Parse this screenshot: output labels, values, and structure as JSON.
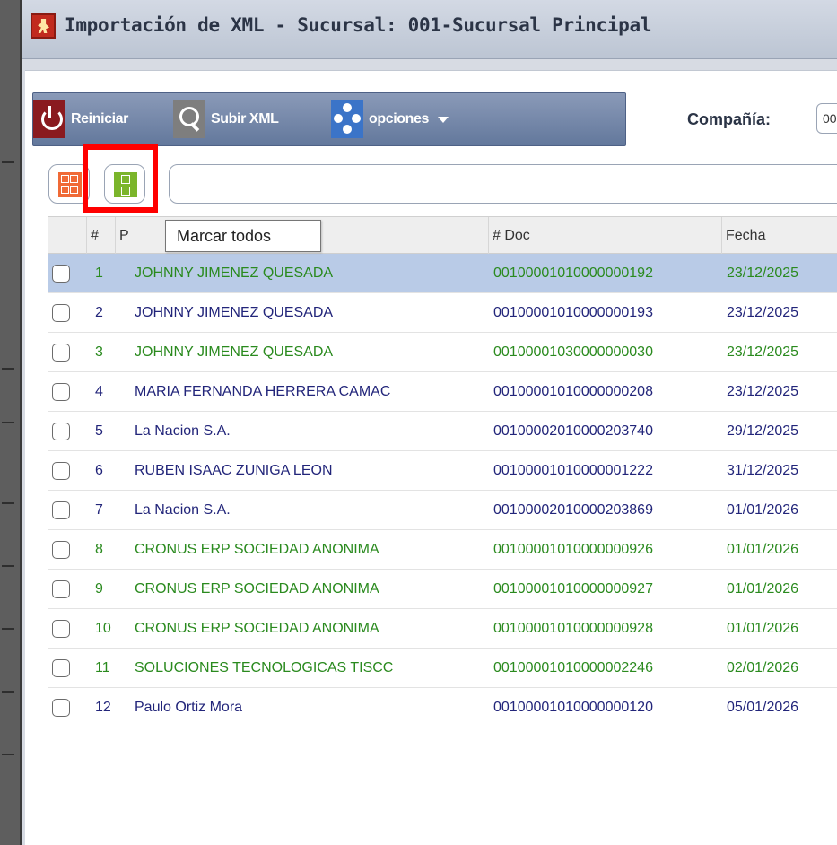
{
  "window": {
    "title": "Importación de XML - Sucursal: 001-Sucursal Principal"
  },
  "toolbar": {
    "reiniciar_label": "Reiniciar",
    "subir_label": "Subir XML",
    "opciones_label": "opciones"
  },
  "company": {
    "label": "Compañía:",
    "value": "00"
  },
  "tooltip": "Marcar todos",
  "table": {
    "columns": [
      "#",
      "P",
      "# Doc",
      "Fecha"
    ],
    "rows": [
      {
        "num": "1",
        "name": "JOHNNY  JIMENEZ QUESADA",
        "doc": "00100001010000000192",
        "date": "23/12/2025",
        "color": "green",
        "selected": true
      },
      {
        "num": "2",
        "name": "JOHNNY  JIMENEZ QUESADA",
        "doc": "00100001010000000193",
        "date": "23/12/2025",
        "color": "blue"
      },
      {
        "num": "3",
        "name": "JOHNNY  JIMENEZ QUESADA",
        "doc": "00100001030000000030",
        "date": "23/12/2025",
        "color": "green"
      },
      {
        "num": "4",
        "name": "MARIA FERNANDA HERRERA CAMAC",
        "doc": "00100001010000000208",
        "date": "23/12/2025",
        "color": "blue"
      },
      {
        "num": "5",
        "name": "La Nacion S.A.",
        "doc": "00100002010000203740",
        "date": "29/12/2025",
        "color": "blue"
      },
      {
        "num": "6",
        "name": "RUBEN ISAAC ZUNIGA LEON",
        "doc": "00100001010000001222",
        "date": "31/12/2025",
        "color": "blue"
      },
      {
        "num": "7",
        "name": "La Nacion S.A.",
        "doc": "00100002010000203869",
        "date": "01/01/2026",
        "color": "blue"
      },
      {
        "num": "8",
        "name": "CRONUS ERP SOCIEDAD ANONIMA",
        "doc": "00100001010000000926",
        "date": "01/01/2026",
        "color": "green"
      },
      {
        "num": "9",
        "name": "CRONUS ERP SOCIEDAD ANONIMA",
        "doc": "00100001010000000927",
        "date": "01/01/2026",
        "color": "green"
      },
      {
        "num": "10",
        "name": "CRONUS ERP SOCIEDAD ANONIMA",
        "doc": "00100001010000000928",
        "date": "01/01/2026",
        "color": "green"
      },
      {
        "num": "11",
        "name": "SOLUCIONES TECNOLOGICAS TISCC",
        "doc": "00100001010000002246",
        "date": "02/01/2026",
        "color": "green"
      },
      {
        "num": "12",
        "name": "Paulo Ortiz Mora",
        "doc": "00100001010000000120",
        "date": "05/01/2026",
        "color": "blue"
      }
    ]
  }
}
